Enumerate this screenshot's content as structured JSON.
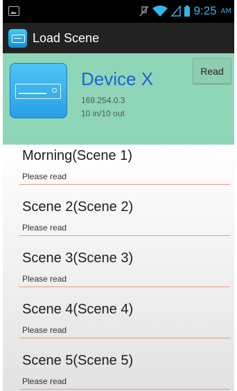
{
  "status_bar": {
    "time": "9:25",
    "ampm": "AM"
  },
  "action_bar": {
    "title": "Load Scene"
  },
  "device": {
    "name": "Device X",
    "ip": "169.254.0.3",
    "io": "10 in/10 out",
    "read_label": "Read"
  },
  "scenes": [
    {
      "title": "Morning(Scene 1)",
      "status": "Please read"
    },
    {
      "title": "Scene 2(Scene 2)",
      "status": "Please read"
    },
    {
      "title": "Scene 3(Scene 3)",
      "status": "Please read"
    },
    {
      "title": "Scene 4(Scene 4)",
      "status": "Please read"
    },
    {
      "title": "Scene 5(Scene 5)",
      "status": "Please read"
    }
  ],
  "colors": {
    "accent": "#33b5e5",
    "header_bg": "#8fd5b7",
    "device_name": "#1b64d8",
    "divider": "#e39a7c"
  }
}
